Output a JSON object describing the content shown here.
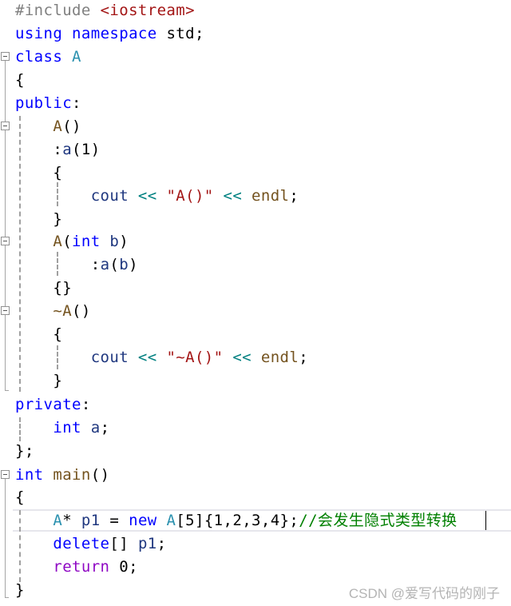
{
  "editor": {
    "lines": [
      {
        "tokens": [
          {
            "t": "#include ",
            "c": "pp"
          },
          {
            "t": "<iostream>",
            "c": "inc"
          }
        ]
      },
      {
        "tokens": [
          {
            "t": "using",
            "c": "kw"
          },
          {
            "t": " "
          },
          {
            "t": "namespace",
            "c": "kw"
          },
          {
            "t": " std;"
          }
        ]
      },
      {
        "tokens": [
          {
            "t": "class",
            "c": "kw"
          },
          {
            "t": " "
          },
          {
            "t": "A",
            "c": "type"
          }
        ]
      },
      {
        "tokens": [
          {
            "t": "{"
          }
        ]
      },
      {
        "tokens": [
          {
            "t": "public",
            "c": "kw"
          },
          {
            "t": ":"
          }
        ]
      },
      {
        "tokens": [
          {
            "t": "    "
          },
          {
            "t": "A",
            "c": "fn"
          },
          {
            "t": "()"
          }
        ]
      },
      {
        "tokens": [
          {
            "t": "    :"
          },
          {
            "t": "a",
            "c": "id"
          },
          {
            "t": "(1)"
          }
        ]
      },
      {
        "tokens": [
          {
            "t": "    {"
          }
        ]
      },
      {
        "tokens": [
          {
            "t": "        "
          },
          {
            "t": "cout",
            "c": "id"
          },
          {
            "t": " "
          },
          {
            "t": "<<",
            "c": "op"
          },
          {
            "t": " "
          },
          {
            "t": "\"A()\"",
            "c": "str"
          },
          {
            "t": " "
          },
          {
            "t": "<<",
            "c": "op"
          },
          {
            "t": " "
          },
          {
            "t": "endl",
            "c": "fn"
          },
          {
            "t": ";"
          }
        ]
      },
      {
        "tokens": [
          {
            "t": "    }"
          }
        ]
      },
      {
        "tokens": [
          {
            "t": "    "
          },
          {
            "t": "A",
            "c": "fn"
          },
          {
            "t": "("
          },
          {
            "t": "int",
            "c": "kw"
          },
          {
            "t": " "
          },
          {
            "t": "b",
            "c": "id"
          },
          {
            "t": ")"
          }
        ]
      },
      {
        "tokens": [
          {
            "t": "        :"
          },
          {
            "t": "a",
            "c": "id"
          },
          {
            "t": "("
          },
          {
            "t": "b",
            "c": "id"
          },
          {
            "t": ")"
          }
        ]
      },
      {
        "tokens": [
          {
            "t": "    {}"
          }
        ]
      },
      {
        "tokens": [
          {
            "t": "    "
          },
          {
            "t": "~A",
            "c": "fn"
          },
          {
            "t": "()"
          }
        ]
      },
      {
        "tokens": [
          {
            "t": "    {"
          }
        ]
      },
      {
        "tokens": [
          {
            "t": "        "
          },
          {
            "t": "cout",
            "c": "id"
          },
          {
            "t": " "
          },
          {
            "t": "<<",
            "c": "op"
          },
          {
            "t": " "
          },
          {
            "t": "\"~A()\"",
            "c": "str"
          },
          {
            "t": " "
          },
          {
            "t": "<<",
            "c": "op"
          },
          {
            "t": " "
          },
          {
            "t": "endl",
            "c": "fn"
          },
          {
            "t": ";"
          }
        ]
      },
      {
        "tokens": [
          {
            "t": "    }"
          }
        ]
      },
      {
        "tokens": [
          {
            "t": "private",
            "c": "kw"
          },
          {
            "t": ":"
          }
        ]
      },
      {
        "tokens": [
          {
            "t": "    "
          },
          {
            "t": "int",
            "c": "kw"
          },
          {
            "t": " "
          },
          {
            "t": "a",
            "c": "id"
          },
          {
            "t": ";"
          }
        ]
      },
      {
        "tokens": [
          {
            "t": "};"
          }
        ]
      },
      {
        "tokens": [
          {
            "t": "int",
            "c": "kw"
          },
          {
            "t": " "
          },
          {
            "t": "main",
            "c": "fn"
          },
          {
            "t": "()"
          }
        ]
      },
      {
        "tokens": [
          {
            "t": "{"
          }
        ]
      },
      {
        "tokens": [
          {
            "t": "    "
          },
          {
            "t": "A",
            "c": "type"
          },
          {
            "t": "* "
          },
          {
            "t": "p1",
            "c": "id"
          },
          {
            "t": " = "
          },
          {
            "t": "new",
            "c": "kw"
          },
          {
            "t": " "
          },
          {
            "t": "A",
            "c": "type"
          },
          {
            "t": "[5]{1,2,3,4};"
          },
          {
            "t": "//会发生隐式类型转换",
            "c": "cm"
          }
        ]
      },
      {
        "tokens": [
          {
            "t": "    "
          },
          {
            "t": "delete",
            "c": "kw"
          },
          {
            "t": "[] "
          },
          {
            "t": "p1",
            "c": "id"
          },
          {
            "t": ";"
          }
        ]
      },
      {
        "tokens": [
          {
            "t": "    "
          },
          {
            "t": "return",
            "c": "ctl"
          },
          {
            "t": " 0;"
          }
        ]
      },
      {
        "tokens": [
          {
            "t": "}"
          }
        ]
      }
    ],
    "fold_markers": [
      "collapse",
      "collapse",
      "collapse",
      "collapse",
      "collapse"
    ]
  },
  "watermark": "CSDN @爱写代码的刚子"
}
